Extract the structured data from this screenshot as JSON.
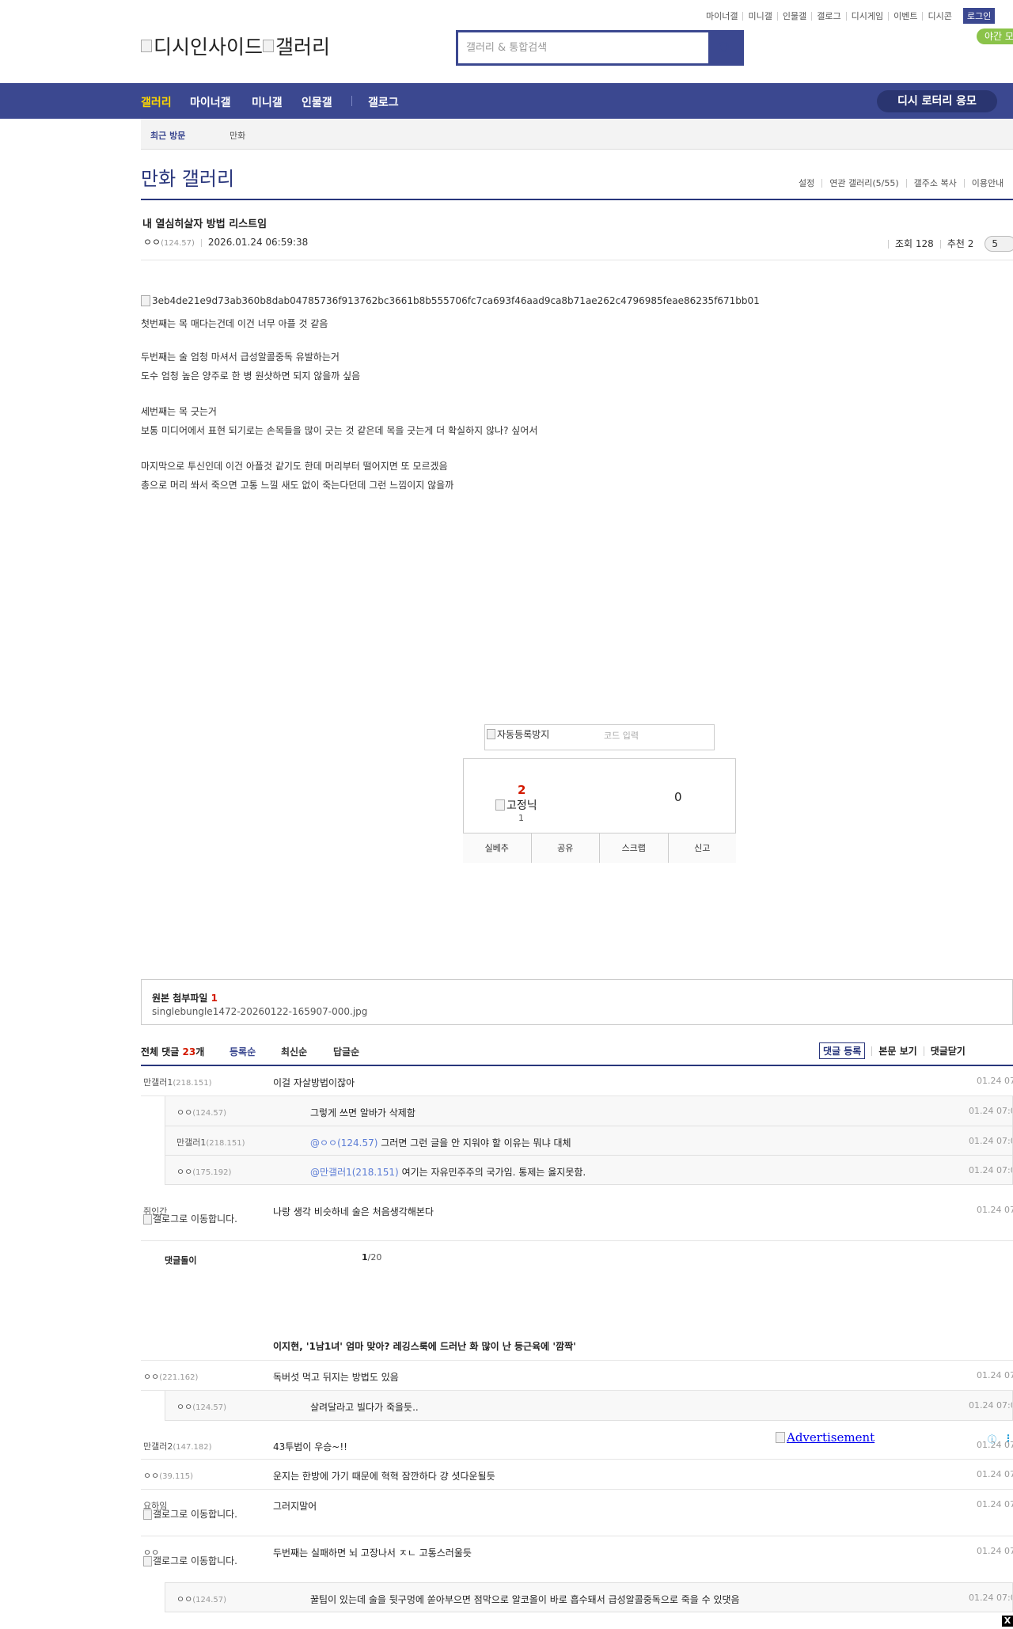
{
  "header": {
    "top_links": [
      "마이너갤",
      "미니갤",
      "인물갤",
      "갤로그",
      "디시게임",
      "이벤트",
      "디시콘"
    ],
    "login": "로그인",
    "night_mode": "야간 모드",
    "logo_site": "디시인사이드",
    "logo_gallery": "갤러리",
    "search_placeholder": "갤러리 & 통합검색"
  },
  "nav": {
    "items": [
      "갤러리",
      "마이너갤",
      "미니갤",
      "인물갤",
      "갤로그"
    ],
    "lottery": "디시 로터리 응모"
  },
  "recent": {
    "title": "최근 방문",
    "item": "만화"
  },
  "gallery": {
    "title": "만화 갤러리",
    "tools": [
      "설정",
      "연관 갤러리(5/55)",
      "갤주소 복사",
      "이용안내"
    ]
  },
  "post": {
    "subject": "내 열심히살자 방법 리스트임",
    "writer": "ㅇㅇ",
    "writer_ip": "(124.57)",
    "date": "2026.01.24 06:59:38",
    "views": "조회 128",
    "recommend": "추천 2",
    "comment_count": "5",
    "image_alt": "3eb4de21e9d73ab360b8dab04785736f913762bc3661b8b555706fc7ca693f46aad9ca8b71ae262c4796985feae86235f671bb01",
    "body": [
      "첫번째는 목 매다는건데 이건 너무 아플 것 같음",
      "두번째는 술 엄청 마셔서 급성알콜중독 유발하는거",
      "도수 엄청 높은 양주로 한 병 원샷하면 되지 않을까 싶음",
      "세번째는 목 긋는거",
      "보통 미디어에서 표현 되기로는 손목들을 많이 긋는 것 같은데 목을 긋는게 더 확실하지 않나? 싶어서",
      "마지막으로 투신인데 이건 아플것 같기도 한데 머리부터 떨어지면 또 모르겠음",
      "총으로 머리 쏴서 죽으면 고통 느낄 새도 없이 죽는다던데 그런 느낌이지 않을까"
    ]
  },
  "captcha": {
    "image_alt": "자동등록방지",
    "placeholder": "코드 입력"
  },
  "recommend_box": {
    "up_count": "2",
    "fixed_alt": "고정닉",
    "fixed_count": "1",
    "down_count": "0",
    "buttons": [
      "실베추",
      "공유",
      "스크랩",
      "신고"
    ]
  },
  "attachment": {
    "title": "원본 첨부파일",
    "count": "1",
    "file": "singlebungle1472-20260122-165907-000.jpg"
  },
  "comments": {
    "total_label": "전체 댓글",
    "total": "23",
    "unit": "개",
    "sort": [
      "등록순",
      "최신순",
      "답글순"
    ],
    "tools": [
      "댓글 등록",
      "본문 보기",
      "댓글닫기"
    ],
    "gallog_alt": "갤로그로 이동합니다.",
    "list": [
      {
        "nick": "만갤러1",
        "ip": "(218.151)",
        "text": "이걸 자살방법이잖아",
        "date": "01.24 07:0"
      },
      {
        "nick": "ㅇㅇ",
        "ip": "(124.57)",
        "text": "그렇게 쓰면 알바가 삭제함",
        "date": "01.24 07:0"
      },
      {
        "nick": "만갤러1",
        "ip": "(218.151)",
        "mention": "@ㅇㅇ(124.57)",
        "text": " 그러면 그런 글을 안 지워야 할 이유는 뭐냐 대체",
        "date": "01.24 07:0"
      },
      {
        "nick": "ㅇㅇ",
        "ip": "(175.192)",
        "mention": "@만갤러1(218.151)",
        "text": " 여기는 자유민주주의 국가임. 통제는 옳지못함.",
        "date": "01.24 07:0"
      },
      {
        "nick": "쥐인간",
        "text": "나랑 생각 비슷하네 술은 처음생각해본다",
        "date": "01.24 07:0"
      },
      {
        "nick": "ㅇㅇ",
        "ip": "(221.162)",
        "text": "독버섯 먹고 뒤지는 방법도 있음",
        "date": "01.24 07:0"
      },
      {
        "nick": "ㅇㅇ",
        "ip": "(124.57)",
        "text": "살려달라고 빌다가 죽을듯..",
        "date": "01.24 07:0"
      },
      {
        "nick": "만갤러2",
        "ip": "(147.182)",
        "text": "43투범이 우승~!!",
        "date": "01.24 07:0"
      },
      {
        "nick": "ㅇㅇ",
        "ip": "(39.115)",
        "text": "운지는 한방에 가기 때문에 혁혁 잠깐하다 걍 셧다운될듯",
        "date": "01.24 07:0"
      },
      {
        "nick": "요하임",
        "text": "그러지말어",
        "date": "01.24 07:0"
      },
      {
        "nick": "ㅇㅇ",
        "text": "두번째는 실패하면 뇌 고장나서 ㅈㄴ 고통스러울듯",
        "date": "01.24 07:0"
      },
      {
        "nick": "ㅇㅇ",
        "ip": "(124.57)",
        "text": "꿀팁이 있는데 술을 뒷구멍에 쏟아부으면 점막으로 알코올이 바로 흡수돼서 급성알콜중독으로 죽을 수 있댓음",
        "date": "01.24 07:0"
      }
    ],
    "dccon_nick": "댓글돌이",
    "dccon_page": "1",
    "dccon_total": "/20",
    "ad_title": "이지현, '1남1녀' 엄마 맞아? 레깅스룩에 드러난 화 많이 난 등근육에 '깜짝'"
  },
  "advert": {
    "link": "Advertisement",
    "close": "X"
  },
  "colors": {
    "brand": "#3b4890",
    "accent": "#ffd800",
    "count_red": "#d31900",
    "mention": "#5b7cd5"
  }
}
